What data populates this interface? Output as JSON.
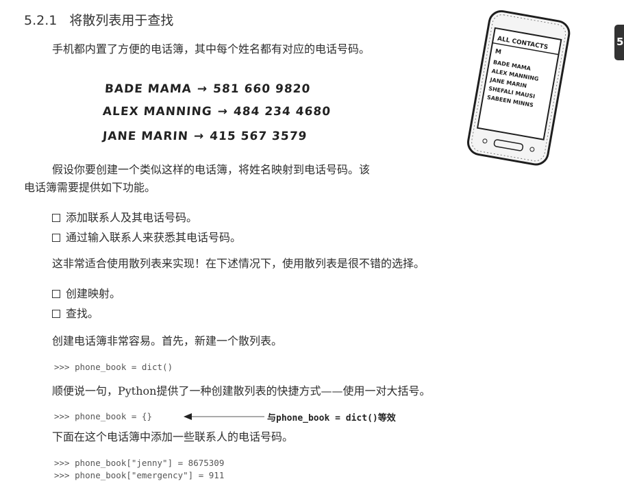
{
  "section": {
    "number": "5.2.1",
    "title": "将散列表用于查找"
  },
  "chapter_tab": "5",
  "paragraphs": {
    "p1": "手机都内置了方便的电话簿，其中每个姓名都有对应的电话号码。",
    "p2a": "假设你要创建一个类似这样的电话簿，将姓名映射到电话号码。该",
    "p2b": "电话簿需要提供如下功能。",
    "p3": "这非常适合使用散列表来实现！在下述情况下，使用散列表是很不错的选择。",
    "p4": "创建电话簿非常容易。首先，新建一个散列表。",
    "p5": "顺便说一句，Python提供了一种创建散列表的快捷方式——使用一对大括号。",
    "p6": "下面在这个电话簿中添加一些联系人的电话号码。"
  },
  "handwritten": [
    {
      "name": "BADE MAMA",
      "arrow": "→",
      "number": "581 660 9820"
    },
    {
      "name": "ALEX MANNING",
      "arrow": "→",
      "number": "484 234 4680"
    },
    {
      "name": "JANE MARIN",
      "arrow": "→",
      "number": "415 567 3579"
    }
  ],
  "phone": {
    "header": "ALL CONTACTS",
    "letter": "M",
    "contacts": [
      "BADE MAMA",
      "ALEX MANNING",
      "JANE MARIN",
      "SHEFALI MAUSI",
      "SABEEN MINNS"
    ]
  },
  "features": [
    "添加联系人及其电话号码。",
    "通过输入联系人来获悉其电话号码。"
  ],
  "uses": [
    "创建映射。",
    "查找。"
  ],
  "code": {
    "line1": ">>> phone_book = dict()",
    "line2": ">>> phone_book = {}",
    "line3": ">>> phone_book[\"jenny\"] = 8675309",
    "line4": ">>> phone_book[\"emergency\"] = 911"
  },
  "annotation": {
    "prefix": "与",
    "code": "phone_book = dict()",
    "suffix": "等效"
  }
}
